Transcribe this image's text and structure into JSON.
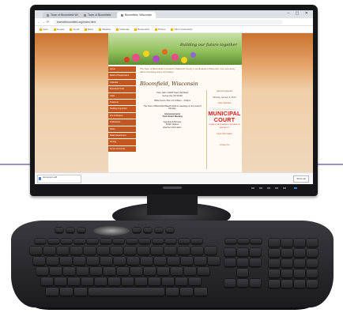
{
  "browser": {
    "tabs": [
      {
        "label": "Town of Bloomfield WI"
      },
      {
        "label": "Town of Bloomfield"
      },
      {
        "label": "Bloomfield, Wisconsin"
      }
    ],
    "window_controls": "– ▢ ✕",
    "nav_icons": {
      "back": "←",
      "forward": "→",
      "reload": "⟳"
    },
    "url": "townofbloomfield.org/index.html",
    "bookmarks": [
      "Apps",
      "Google",
      "Gmail",
      "Maps",
      "Weather",
      "Calendar",
      "Bookmarks",
      "Photos",
      "Other bookmarks"
    ]
  },
  "site": {
    "tagline": "Building our future together",
    "nav_items": [
      "Home",
      "Board of Supervisors",
      "Calendar",
      "Municipal Court",
      "Clerk",
      "Treasurer",
      "Building Inspection",
      "Fire & Rescue",
      "Ordinances",
      "Parks",
      "Road Department",
      "Zoning",
      "Forms & Permits"
    ],
    "intro": "The Town of Bloomfield is located in Walworth County in southeastern Wisconsin. Our community offers rural living and a rich history.",
    "town_name": "Bloomfield, Wisconsin",
    "center_blocks": [
      "Town Hall • N1100 Town Hall Road\nGenoa City, WI 53128",
      "Office Hours: Mon–Fri 9:00am – 4:00pm",
      "The Town of Bloomfield Board holds its meetings on the second Monday",
      "Announcements\nTown Board Meeting",
      "Agendas & Minutes\nPublic Notices\nElection Information"
    ],
    "side_blocks": {
      "top": "Upcoming Events",
      "date": "Monday, January 8, 2024",
      "link1": "View Calendar",
      "court_title": "MUNICIPAL COURT",
      "court_dash": "––––––––––––––",
      "court_sub": "TOWN OF BLOOMFIELD / VILLAGE OF GENOA CITY",
      "link2": "Court Information",
      "link3": "Contact Us"
    }
  },
  "status_bar": {
    "download": "document.pdf",
    "show_all": "Show all"
  },
  "colors": {
    "nav_orange": "#c3571f",
    "court_red": "#d31b1b",
    "bezel": "#161618"
  }
}
